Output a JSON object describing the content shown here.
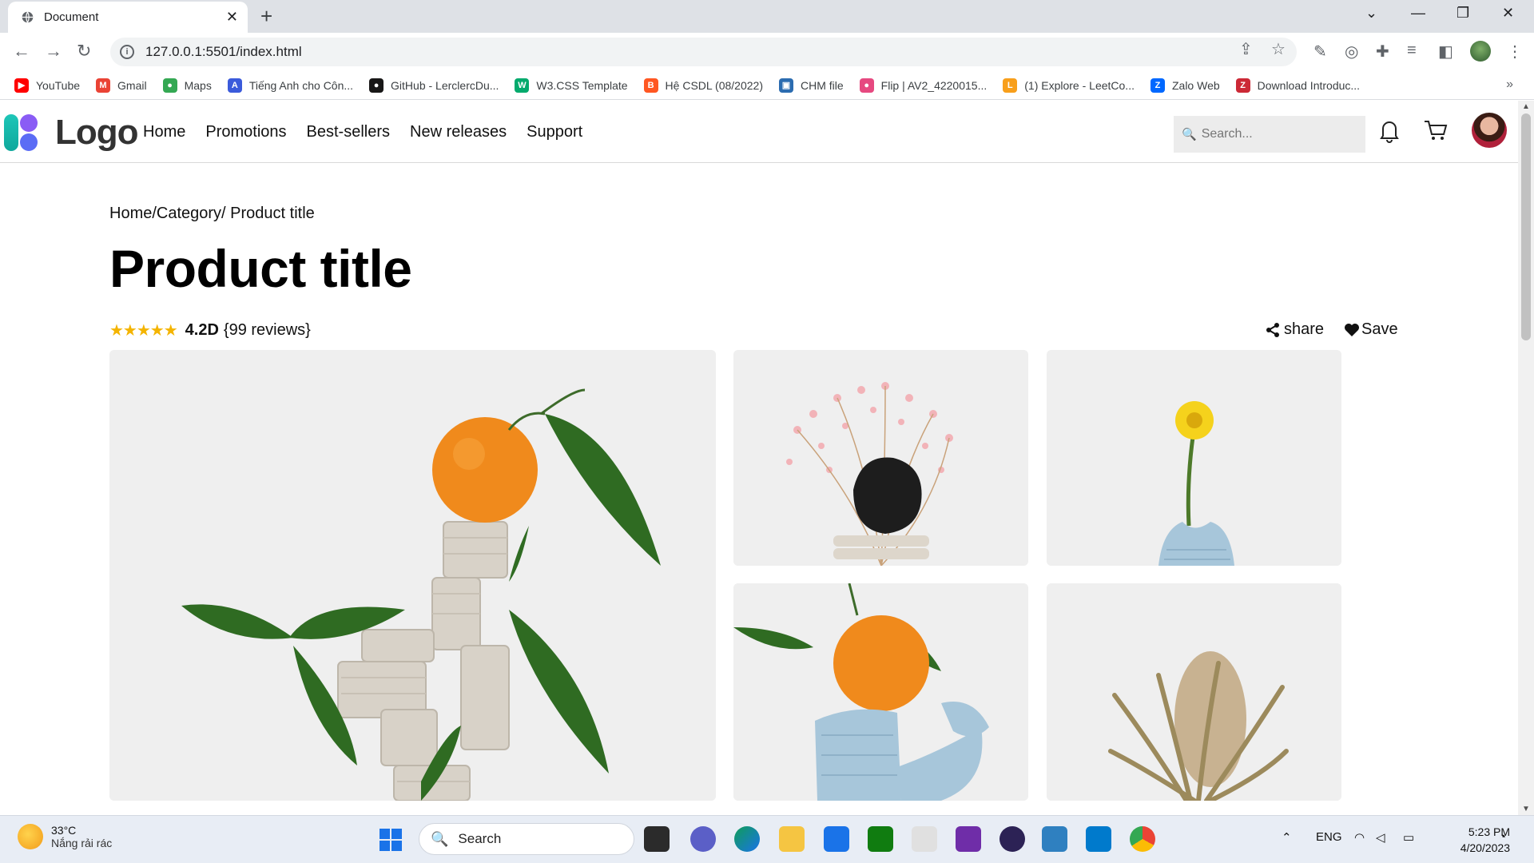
{
  "browser": {
    "tab_title": "Document",
    "tab_close": "✕",
    "new_tab": "+",
    "url": "127.0.0.1:5501/index.html",
    "bookmarks": [
      {
        "label": "YouTube",
        "icon": "youtube-icon",
        "color": "#ff0000",
        "glyph": "▶"
      },
      {
        "label": "Gmail",
        "icon": "gmail-icon",
        "color": "#ea4335",
        "glyph": "M"
      },
      {
        "label": "Maps",
        "icon": "maps-icon",
        "color": "#34a853",
        "glyph": "●"
      },
      {
        "label": "Tiếng Anh cho Côn...",
        "icon": "english-site-icon",
        "color": "#3b5bdb",
        "glyph": "A"
      },
      {
        "label": "GitHub - LerclercDu...",
        "icon": "github-icon",
        "color": "#181717",
        "glyph": "●"
      },
      {
        "label": "W3.CSS Template",
        "icon": "w3schools-icon",
        "color": "#04aa6d",
        "glyph": "W"
      },
      {
        "label": "Hệ CSDL (08/2022)",
        "icon": "blogger-icon",
        "color": "#ff5722",
        "glyph": "B"
      },
      {
        "label": "CHM file",
        "icon": "chm-file-icon",
        "color": "#2b6cb0",
        "glyph": "▣"
      },
      {
        "label": "Flip | AV2_4220015...",
        "icon": "flip-icon",
        "color": "#e64980",
        "glyph": "●"
      },
      {
        "label": "(1) Explore - LeetCo...",
        "icon": "leetcode-icon",
        "color": "#f89f1b",
        "glyph": "L"
      },
      {
        "label": "Zalo Web",
        "icon": "zalo-icon",
        "color": "#0068ff",
        "glyph": "Z"
      },
      {
        "label": "Download Introduc...",
        "icon": "zotero-icon",
        "color": "#cc2936",
        "glyph": "Z"
      }
    ],
    "bookmarks_more": "»"
  },
  "site": {
    "logo_text": "Logo",
    "nav": [
      "Home",
      "Promotions",
      "Best-sellers",
      "New releases",
      "Support"
    ],
    "search_placeholder": "Search..."
  },
  "product": {
    "breadcrumb": "Home/Category/ Product title",
    "title": "Product title",
    "stars": "★★★★★",
    "rating_value": 4.2,
    "score_text": "4.2D",
    "reviews_text": "{99 reviews}",
    "share_label": "share",
    "save_label": "Save",
    "images": [
      {
        "name": "main-photo-orange-sculpture",
        "subject": "orange on white clay sculpture with leaves"
      },
      {
        "name": "photo-pink-flowers-stone",
        "subject": "pink dried flowers with black stone"
      },
      {
        "name": "photo-yellow-flower-vase",
        "subject": "yellow flower in light blue vase"
      },
      {
        "name": "photo-orange-blue-sculpture",
        "subject": "orange on blue clay sculpture"
      },
      {
        "name": "photo-dried-banksia",
        "subject": "dried banksia flower"
      }
    ]
  },
  "taskbar": {
    "temperature": "33°C",
    "weather_text": "Nắng rải rác",
    "search_label": "Search",
    "language": "ENG",
    "time": "5:23 PM",
    "date": "4/20/2023"
  }
}
